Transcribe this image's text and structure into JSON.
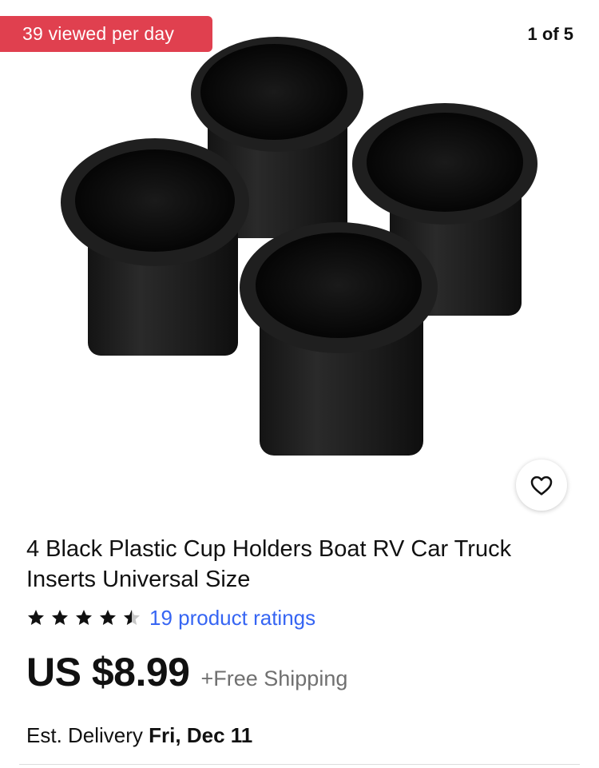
{
  "gallery": {
    "views_badge": "39 viewed per day",
    "counter": "1 of 5",
    "image_subject": "four black plastic cup holder inserts"
  },
  "favorite": {
    "icon": "heart-icon"
  },
  "listing": {
    "title": "4 Black Plastic Cup Holders Boat RV Car Truck Inserts Universal Size",
    "rating_stars": 4.5,
    "ratings_text": "19 product ratings",
    "price": "US $8.99",
    "shipping": "+Free Shipping",
    "delivery_label": "Est. Delivery",
    "delivery_date": "Fri, Dec 11"
  },
  "colors": {
    "badge": "#e0404f",
    "link": "#3665f3",
    "text": "#111111",
    "muted": "#707070"
  }
}
